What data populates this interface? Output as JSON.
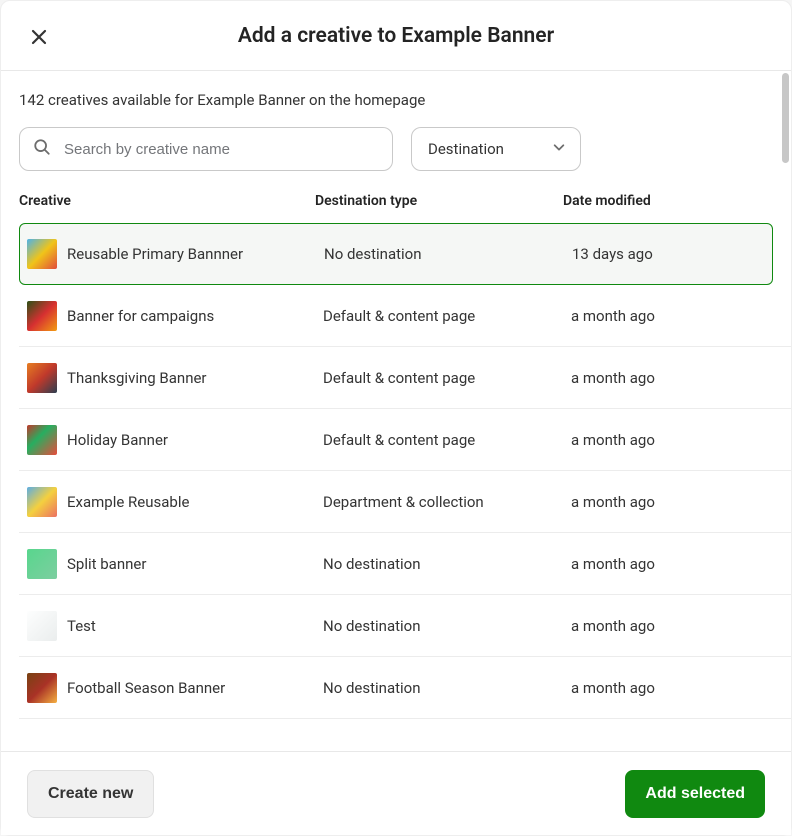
{
  "header": {
    "title": "Add a creative to Example Banner"
  },
  "subtitle": "142 creatives available for Example Banner on the homepage",
  "search": {
    "placeholder": "Search by creative name"
  },
  "destination_select": {
    "label": "Destination"
  },
  "columns": {
    "creative": "Creative",
    "destination": "Destination type",
    "date": "Date modified"
  },
  "rows": [
    {
      "name": "Reusable Primary Bannner",
      "destination": "No destination",
      "date": "13 days ago",
      "selected": true
    },
    {
      "name": "Banner for campaigns",
      "destination": "Default & content page",
      "date": "a month ago",
      "selected": false
    },
    {
      "name": "Thanksgiving Banner",
      "destination": "Default & content page",
      "date": "a month ago",
      "selected": false
    },
    {
      "name": "Holiday Banner",
      "destination": "Default & content page",
      "date": "a month ago",
      "selected": false
    },
    {
      "name": "Example Reusable",
      "destination": "Department & collection",
      "date": "a month ago",
      "selected": false
    },
    {
      "name": "Split banner",
      "destination": "No destination",
      "date": "a month ago",
      "selected": false
    },
    {
      "name": "Test",
      "destination": "No destination",
      "date": "a month ago",
      "selected": false
    },
    {
      "name": "Football Season Banner",
      "destination": "No destination",
      "date": "a month ago",
      "selected": false
    }
  ],
  "footer": {
    "create_label": "Create new",
    "add_label": "Add selected"
  }
}
